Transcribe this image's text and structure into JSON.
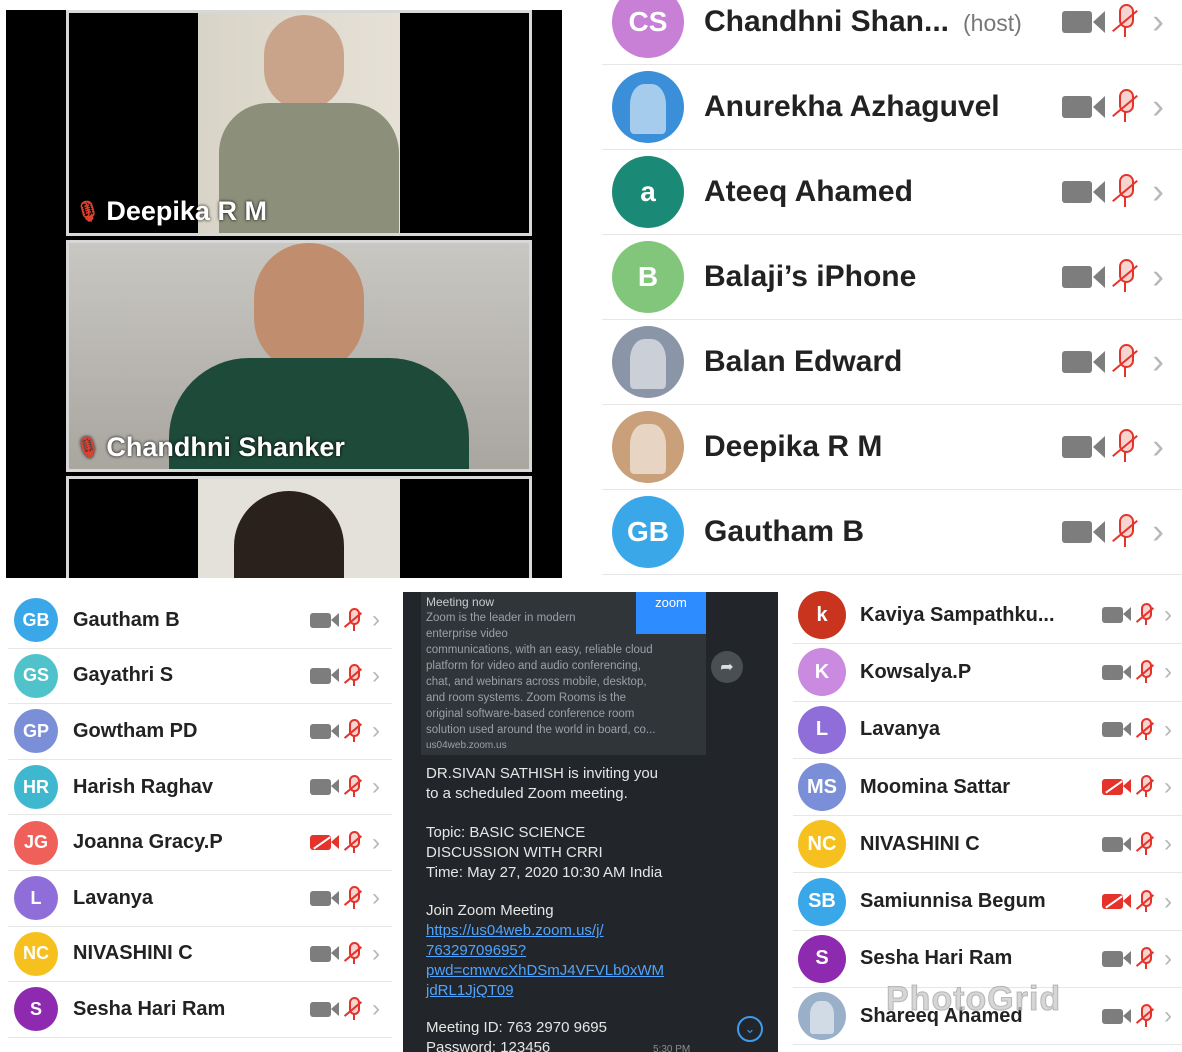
{
  "colors": {
    "mute_red": "#e4332b",
    "cam_gray": "#7d7d7d",
    "link_blue": "#4ea4ff",
    "zoom_blue": "#2d8cff"
  },
  "video": {
    "tiles": [
      {
        "name": "Deepika R M",
        "muted": true
      },
      {
        "name": "Chandhni Shanker",
        "muted": true
      },
      {
        "name": "",
        "muted": false
      }
    ]
  },
  "panel_top_right": {
    "participants": [
      {
        "initials": "CS",
        "name": "Chandhni Shan...",
        "host_label": "(host)",
        "avatar_color": "#c87fd6",
        "camera_off": false
      },
      {
        "initials": "",
        "name": "Anurekha Azhaguvel",
        "avatar_color": "#3a8fd8",
        "avatar_image": "dove-photo",
        "camera_off": false
      },
      {
        "initials": "a",
        "name": "Ateeq Ahamed",
        "avatar_color": "#1a8a76",
        "camera_off": false
      },
      {
        "initials": "B",
        "name": "Balaji’s iPhone",
        "avatar_color": "#82c67c",
        "camera_off": false
      },
      {
        "initials": "",
        "name": "Balan Edward",
        "avatar_color": "#8a96a8",
        "avatar_image": "eagle-photo",
        "camera_off": false
      },
      {
        "initials": "",
        "name": "Deepika R M",
        "avatar_color": "#c9a07a",
        "avatar_image": "person-photo",
        "camera_off": false
      },
      {
        "initials": "GB",
        "name": "Gautham B",
        "avatar_color": "#3aa8e8",
        "camera_off": false
      }
    ]
  },
  "panel_bottom_left": {
    "participants": [
      {
        "initials": "GB",
        "name": "Gautham B",
        "avatar_color": "#3aa8e8",
        "camera_off": false
      },
      {
        "initials": "GS",
        "name": "Gayathri S",
        "avatar_color": "#4fc3c9",
        "camera_off": false
      },
      {
        "initials": "GP",
        "name": "Gowtham PD",
        "avatar_color": "#7b8fd9",
        "camera_off": false
      },
      {
        "initials": "HR",
        "name": "Harish Raghav",
        "avatar_color": "#3fb7cf",
        "camera_off": false
      },
      {
        "initials": "JG",
        "name": "Joanna Gracy.P",
        "avatar_color": "#f0605a",
        "camera_off": true
      },
      {
        "initials": "L",
        "name": "Lavanya",
        "avatar_color": "#8f6ed9",
        "camera_off": false
      },
      {
        "initials": "NC",
        "name": "NIVASHINI C",
        "avatar_color": "#f6c11f",
        "camera_off": false
      },
      {
        "initials": "S",
        "name": "Sesha Hari Ram",
        "avatar_color": "#8e2ab0",
        "camera_off": false
      }
    ]
  },
  "panel_bottom_right": {
    "participants": [
      {
        "initials": "k",
        "name": "Kaviya Sampathku...",
        "avatar_color": "#c8341e",
        "camera_off": false
      },
      {
        "initials": "K",
        "name": "Kowsalya.P",
        "avatar_color": "#c98ae0",
        "camera_off": false
      },
      {
        "initials": "L",
        "name": "Lavanya",
        "avatar_color": "#8f6ed9",
        "camera_off": false
      },
      {
        "initials": "MS",
        "name": "Moomina Sattar",
        "avatar_color": "#7b8fd9",
        "camera_off": true
      },
      {
        "initials": "NC",
        "name": "NIVASHINI C",
        "avatar_color": "#f6c11f",
        "camera_off": false
      },
      {
        "initials": "SB",
        "name": "Samiunnisa Begum",
        "avatar_color": "#3aa8e8",
        "camera_off": true
      },
      {
        "initials": "S",
        "name": "Sesha Hari Ram",
        "avatar_color": "#8e2ab0",
        "camera_off": false
      },
      {
        "initials": "",
        "name": "Shareeq Ahamed",
        "avatar_color": "#9ab0c8",
        "avatar_image": "person-photo",
        "camera_off": false
      }
    ]
  },
  "chat": {
    "preview_title": "Meeting now",
    "preview_lines": [
      "Zoom is the leader in modern",
      "enterprise video",
      "communications, with an easy, reliable cloud",
      "platform for video and audio conferencing,",
      "chat, and webinars across mobile, desktop,",
      "and room systems. Zoom Rooms is the",
      "original software-based conference room",
      "solution used around the world in board, co..."
    ],
    "preview_domain": "us04web.zoom.us",
    "preview_thumb": "zoom",
    "invite_lines": [
      "DR.SIVAN SATHISH is inviting you",
      "to a scheduled Zoom meeting."
    ],
    "topic_lines": [
      "Topic: BASIC SCIENCE",
      "DISCUSSION WITH CRRI",
      "Time: May 27, 2020 10:30 AM India"
    ],
    "join_label": "Join Zoom Meeting",
    "link_lines": [
      "https://us04web.zoom.us/j/",
      "76329709695?",
      "pwd=cmwvcXhDSmJ4VFVLb0xWM",
      "jdRL1JjQT09"
    ],
    "meeting_id": "Meeting ID: 763 2970 9695",
    "password": "Password: 123456",
    "time": "5:30 PM"
  },
  "watermark": "PhotoGrid"
}
